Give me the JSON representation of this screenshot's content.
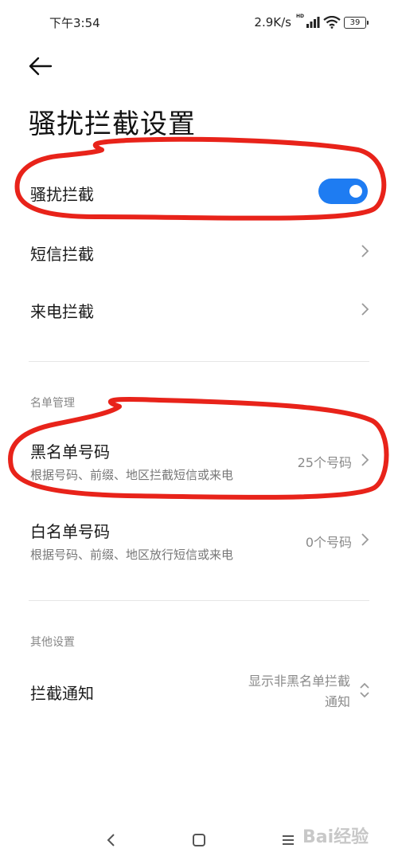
{
  "status_bar": {
    "time": "下午3:54",
    "net_speed": "2.9K/s",
    "hd_label": "HD",
    "battery": "39"
  },
  "header": {
    "title": "骚扰拦截设置"
  },
  "main_toggle": {
    "label": "骚扰拦截",
    "enabled": true
  },
  "rows": {
    "sms_block": "短信拦截",
    "call_block": "来电拦截"
  },
  "list_section": {
    "heading": "名单管理",
    "blacklist": {
      "title": "黑名单号码",
      "subtitle": "根据号码、前缀、地区拦截短信或来电",
      "value": "25个号码"
    },
    "whitelist": {
      "title": "白名单号码",
      "subtitle": "根据号码、前缀、地区放行短信或来电",
      "value": "0个号码"
    }
  },
  "other_section": {
    "heading": "其他设置",
    "notify": {
      "label": "拦截通知",
      "value_line1": "显示非黑名单拦截",
      "value_line2": "通知"
    }
  },
  "watermark": "Bai经验",
  "colors": {
    "accent": "#1e7cf2",
    "annotation": "#e8231a"
  }
}
